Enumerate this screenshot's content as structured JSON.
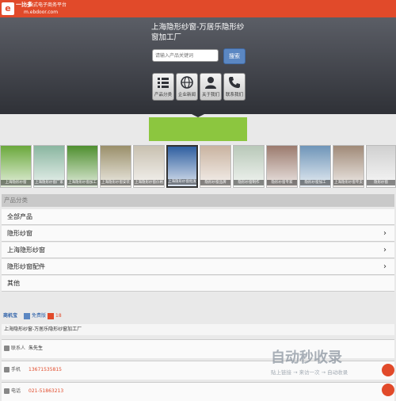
{
  "topbar": {
    "logo_mark": "e",
    "logo_name": "一比多",
    "slogan_line1": "一站式电子商务平台",
    "slogan_line2": "m.ebdoor.com"
  },
  "hero": {
    "store_title": "上海隐形纱窗-万居乐隐形纱窗加工厂",
    "search_placeholder": "请输入产品关键词",
    "search_button": "搜索",
    "nav": [
      {
        "label": "产品分类",
        "icon": "list-icon"
      },
      {
        "label": "企业新闻",
        "icon": "globe-icon"
      },
      {
        "label": "关于我们",
        "icon": "user-icon"
      },
      {
        "label": "联系我们",
        "icon": "phone-icon"
      }
    ]
  },
  "gallery": {
    "thumbs": [
      {
        "caption": "上海隐形纱窗",
        "color": "#6aa83b"
      },
      {
        "caption": "上海隐形纱窗厂家",
        "color": "#8ab6a0"
      },
      {
        "caption": "上海隐形纱窗加工",
        "color": "#4f8f2f"
      },
      {
        "caption": "上海隐形纱窗安装",
        "color": "#9a8f6a"
      },
      {
        "caption": "上海隐形纱窗价格",
        "color": "#c8c0b0"
      },
      {
        "caption": "上海隐形纱窗批发",
        "color": "#2f5fa0"
      },
      {
        "caption": "隐形纱窗品牌",
        "color": "#c9b3a0"
      },
      {
        "caption": "隐形纱窗制作",
        "color": "#b8c8b8"
      },
      {
        "caption": "隐形纱窗专家",
        "color": "#9b7b6e"
      },
      {
        "caption": "隐形纱窗加工",
        "color": "#6f95b8"
      },
      {
        "caption": "上海隐形纱窗专卖",
        "color": "#a08a78"
      },
      {
        "caption": "隐形纱窗",
        "color": "#d0d0d0"
      }
    ]
  },
  "categories": {
    "header": "产品分类",
    "items": [
      {
        "label": "全部产品",
        "arrow": ""
      },
      {
        "label": "隐形纱窗",
        "arrow": "›"
      },
      {
        "label": "上海隐形纱窗",
        "arrow": "›"
      },
      {
        "label": "隐形纱窗配件",
        "arrow": "›"
      },
      {
        "label": "其他",
        "arrow": ""
      }
    ]
  },
  "footer": {
    "brand_tab": "商机宝",
    "free_tab": "免费版",
    "vip_badge": "18",
    "company": "上海隐形纱窗-万居乐隐形纱窗加工厂"
  },
  "contact": {
    "rows": [
      {
        "label": "联系人",
        "value": "朱先生",
        "value_color": "#222"
      },
      {
        "label": "手机",
        "value": "13671535815",
        "value_color": "#e14a2a"
      },
      {
        "label": "电话",
        "value": "021-51863213",
        "value_color": "#e14a2a"
      }
    ]
  },
  "watermark": {
    "big": "自动秒收录",
    "sub": "贴上链接 → 来访一次 → 自动收录"
  },
  "colors": {
    "accent": "#e14a2a",
    "hero_top": "#5b5e66",
    "banner": "#8cc63f",
    "button": "#5b87c2"
  }
}
